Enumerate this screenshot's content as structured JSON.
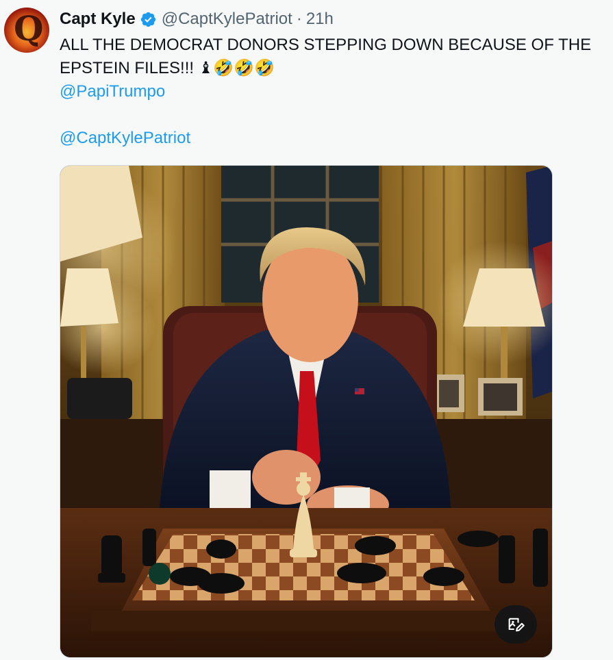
{
  "tweet": {
    "author_name": "Capt Kyle",
    "handle": "@CaptKylePatriot",
    "separator": "·",
    "time": "21h",
    "verified": true,
    "text_line": "ALL THE DEMOCRAT DONORS STEPPING DOWN BECAUSE OF THE EPSTEIN FILES!!! ♝🤣🤣🤣",
    "mention_1": "@PapiTrumpo",
    "mention_2": "@CaptKylePatriot"
  },
  "media": {
    "alt_icon": "edit-image-icon"
  },
  "colors": {
    "link": "#1d9bf0",
    "secondary_text": "#536471",
    "verified_badge": "#1d9bf0"
  }
}
